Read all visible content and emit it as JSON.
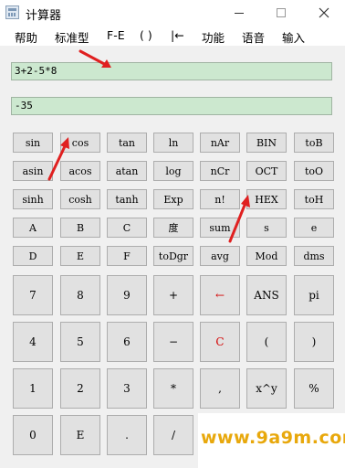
{
  "window": {
    "title": "计算器",
    "minimize": "—",
    "maximize": "☐",
    "close": "✕"
  },
  "menu": [
    "帮助",
    "标准型",
    "F-E",
    "( )",
    "|←",
    "功能",
    "语音",
    "输入"
  ],
  "display": {
    "expression": "3+2-5*8",
    "result": "-35"
  },
  "function_keys": [
    [
      "sin",
      "cos",
      "tan",
      "ln",
      "nAr",
      "BIN",
      "toB"
    ],
    [
      "asin",
      "acos",
      "atan",
      "log",
      "nCr",
      "OCT",
      "toO"
    ],
    [
      "sinh",
      "cosh",
      "tanh",
      "Exp",
      "n!",
      "HEX",
      "toH"
    ],
    [
      "A",
      "B",
      "C",
      "度",
      "sum",
      "s",
      "e"
    ],
    [
      "D",
      "E",
      "F",
      "toDgr",
      "avg",
      "Mod",
      "dms"
    ]
  ],
  "main_keys": [
    [
      "7",
      "8",
      "9",
      "+",
      "←",
      "ANS",
      "pi"
    ],
    [
      "4",
      "5",
      "6",
      "−",
      "C",
      "(",
      ")"
    ],
    [
      "1",
      "2",
      "3",
      "*",
      ",",
      "x^y",
      "%"
    ],
    [
      "0",
      "E",
      ".",
      "/",
      "",
      "",
      ""
    ]
  ],
  "accent_color": "#d40000",
  "watermark": {
    "text": "www.9a9m.com",
    "color": "#e8a80c"
  }
}
